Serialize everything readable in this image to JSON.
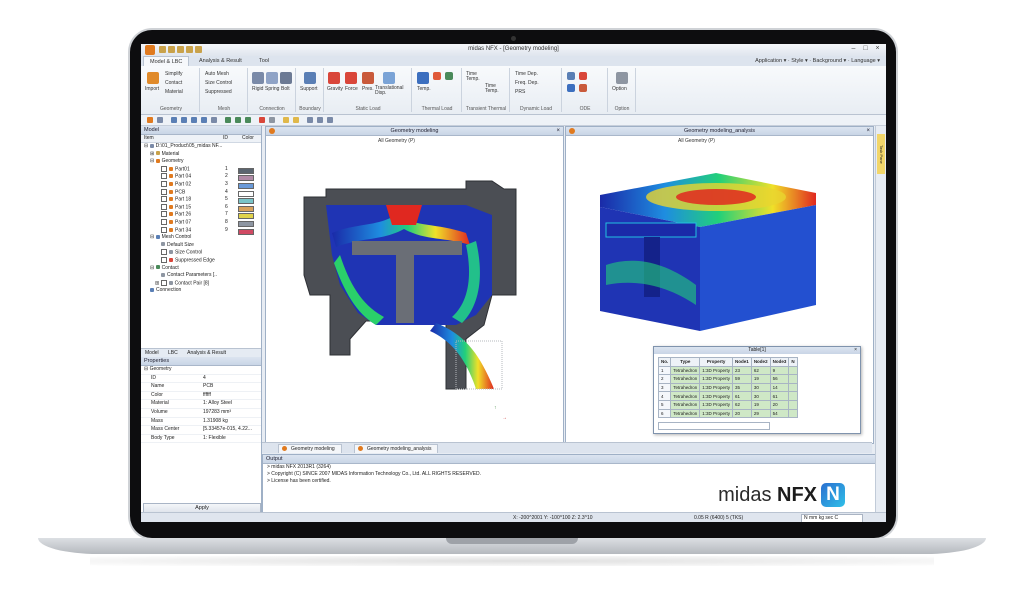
{
  "app": {
    "window_title": "midas NFX - [Geometry modeling]",
    "tabs": [
      "Model & LBC",
      "Analysis & Result",
      "Tool"
    ],
    "active_tab": 0,
    "top_right": [
      "Application",
      "Style",
      "Background",
      "Language"
    ]
  },
  "ribbon": {
    "geometry": {
      "label": "Geometry",
      "items": [
        "Import",
        "Simplify",
        "Contact",
        "Material"
      ]
    },
    "mesh": {
      "label": "Mesh",
      "items": [
        "Auto Mesh",
        "Size Control",
        "Suppressed"
      ]
    },
    "connection": {
      "label": "Connection",
      "items": [
        "Rigid",
        "Spring",
        "Bolt"
      ]
    },
    "boundary": {
      "label": "Boundary",
      "items": [
        "Support"
      ]
    },
    "static_load": {
      "label": "Static Load",
      "items": [
        "Gravity",
        "Force",
        "Pres.",
        "Translational Disp."
      ]
    },
    "thermal_load": {
      "label": "Thermal Load",
      "items": [
        "Temp."
      ]
    },
    "transient_thermal": {
      "label": "Transient Thermal",
      "items": [
        "Time Temp.",
        "Time Temp."
      ]
    },
    "dynamic_load": {
      "label": "Dynamic Load",
      "items": [
        "Time Dep.",
        "Freq. Dep.",
        "PRS"
      ]
    },
    "ode": {
      "label": "ODE",
      "items": []
    },
    "option": {
      "label": "Option",
      "items": [
        "Option"
      ]
    }
  },
  "model_tree": {
    "panel_title": "Model",
    "headers": [
      "Item",
      "ID",
      "Color"
    ],
    "root": "D:\\01_Product\\05_midas NF...",
    "material": "Material",
    "geometry": "Geometry",
    "parts": [
      {
        "name": "Part01",
        "id": "1",
        "color": "#5b6570"
      },
      {
        "name": "Part 04",
        "id": "2",
        "color": "#b08aa6"
      },
      {
        "name": "Part 02",
        "id": "3",
        "color": "#6a9ad8"
      },
      {
        "name": "PCB",
        "id": "4",
        "color": "#ffffff"
      },
      {
        "name": "Part 18",
        "id": "5",
        "color": "#7ac4c8"
      },
      {
        "name": "Part 15",
        "id": "6",
        "color": "#d8a25c"
      },
      {
        "name": "Part 26",
        "id": "7",
        "color": "#e0d24a"
      },
      {
        "name": "Part 07",
        "id": "8",
        "color": "#8e96a2"
      },
      {
        "name": "Part 34",
        "id": "9",
        "color": "#d04a63"
      }
    ],
    "mesh_control": "Mesh Control",
    "mesh_items": [
      "Default Size",
      "Size Control",
      "Suppressed Edge"
    ],
    "contact": "Contact",
    "contact_items": [
      "Contact Parameters [..",
      "Contact Pair [8]"
    ],
    "connection": "Connection"
  },
  "panel_tabs": [
    "Model",
    "LBC",
    "Analysis & Result"
  ],
  "properties": {
    "title": "Properties",
    "section": "Geometry",
    "rows": [
      {
        "k": "ID",
        "v": "4"
      },
      {
        "k": "Name",
        "v": "PCB"
      },
      {
        "k": "Color",
        "v": "ffffff"
      },
      {
        "k": "Material",
        "v": "1: Alloy Steel"
      },
      {
        "k": "Volume",
        "v": "197283 mm³"
      },
      {
        "k": "Mass",
        "v": "1.31908 kg"
      },
      {
        "k": "Mass Center",
        "v": "[5.33457e-015, 4.22..."
      },
      {
        "k": "Body Type",
        "v": "1: Flexible"
      }
    ],
    "apply": "Apply"
  },
  "views": [
    {
      "title": "Geometry modeling",
      "geo_label": "All Geometry (P)"
    },
    {
      "title": "Geometry modeling_analysis",
      "geo_label": "All Geometry (P)"
    }
  ],
  "doc_tabs": [
    "Geometry modeling",
    "Geometry modeling_analysis"
  ],
  "table_window": {
    "title": "Table[1]",
    "headers": [
      "No.",
      "Type",
      "Property",
      "Node1",
      "Node2",
      "Node3",
      "N"
    ],
    "rows": [
      [
        "1",
        "Tetrahedron",
        "1:3D Property",
        "23",
        "62",
        "9"
      ],
      [
        "2",
        "Tetrahedron",
        "1:3D Property",
        "59",
        "19",
        "56"
      ],
      [
        "3",
        "Tetrahedron",
        "1:3D Property",
        "35",
        "30",
        "14"
      ],
      [
        "4",
        "Tetrahedron",
        "1:3D Property",
        "61",
        "30",
        "61"
      ],
      [
        "5",
        "Tetrahedron",
        "1:3D Property",
        "62",
        "19",
        "20"
      ],
      [
        "6",
        "Tetrahedron",
        "1:3D Property",
        "20",
        "29",
        "54"
      ]
    ]
  },
  "output": {
    "title": "Output",
    "lines": [
      "> midas NFX 2013R1 (3264)",
      "> Copyright (C) SINCE 2007 MIDAS Information Technology Co., Ltd. ALL RIGHTS RESERVED.",
      "> License has been certified."
    ]
  },
  "status": {
    "coords": "X: -200^2001 Y: -100^100 Z: 2.3^10",
    "info": "0.05 R (6400) 5 (TKS)",
    "units": "N mm kg sec C"
  },
  "brand": {
    "text_light": "midas ",
    "text_bold": "NFX",
    "logo_letter": "N"
  },
  "right_tag": "Task Pane",
  "colors": {
    "accent": "#e07a1f",
    "brand_gradient_start": "#2a6fd0",
    "brand_gradient_end": "#2fc0e8"
  }
}
